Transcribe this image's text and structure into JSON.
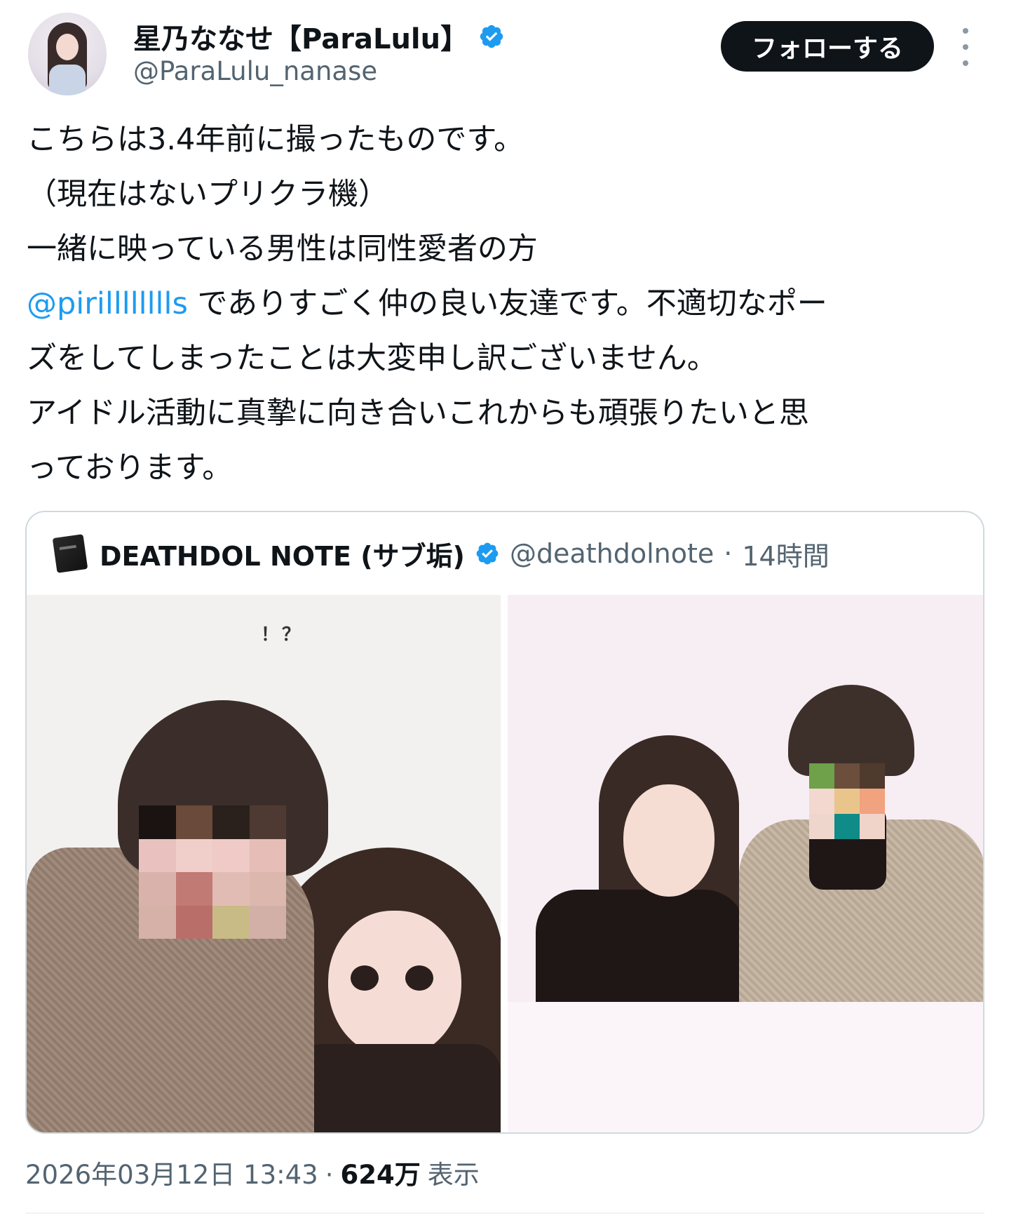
{
  "author": {
    "display_name": "星乃ななせ【ParaLulu】",
    "handle": "@ParaLulu_nanase",
    "avatar_icon": "profile-photo",
    "verified_icon": "verified-badge-icon",
    "verified_color": "#1d9bf0"
  },
  "actions": {
    "follow_label": "フォローする",
    "more_icon": "more-vertical-icon"
  },
  "tweet": {
    "lines": [
      "こちらは3.4年前に撮ったものです。",
      "（現在はないプリクラ機）",
      "一緒に映っている男性は同性愛者の方"
    ],
    "mention": "@pirilllllllls",
    "line4_rest": " でありすごく仲の良い友達です。不適切なポー",
    "line5": "ズをしてしまったことは大変申し訳ございません。",
    "line6": "アイドル活動に真摯に向き合いこれからも頑張りたいと思",
    "line7": "っております。"
  },
  "quote": {
    "icon": "notebook-emoji-icon",
    "name": "DEATHDOL NOTE (サブ垢)",
    "handle": "@deathdolnote",
    "separator": "·",
    "time": "14時間",
    "left_caption": "！？"
  },
  "footer": {
    "timestamp": "2026年03月12日 13:43",
    "separator": "·",
    "views_count": "624万",
    "views_label": "表示"
  },
  "colors": {
    "text_primary": "#0f1419",
    "text_secondary": "#536471",
    "link": "#1d9bf0",
    "follow_button_bg": "#0f1419",
    "border": "#cfd9de"
  }
}
